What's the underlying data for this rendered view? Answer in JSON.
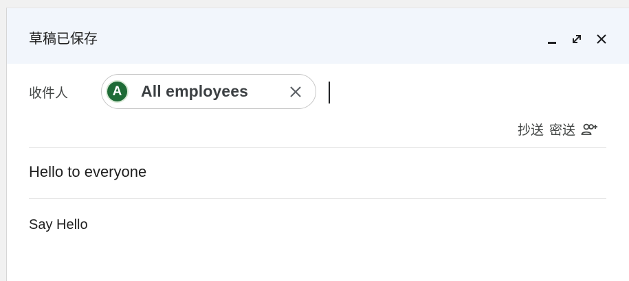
{
  "header": {
    "title": "草稿已保存",
    "minimize_icon": "minimize-icon",
    "expand_icon": "expand-icon",
    "close_icon": "close-icon"
  },
  "recipients": {
    "to_label": "收件人",
    "chips": [
      {
        "avatar_letter": "A",
        "name": "All employees",
        "avatar_color": "#1e6b36"
      }
    ]
  },
  "cc_bcc": {
    "cc_label": "抄送",
    "bcc_label": "密送",
    "add_people_icon": "add-people-icon"
  },
  "subject": "Hello to everyone",
  "body": "Say Hello"
}
